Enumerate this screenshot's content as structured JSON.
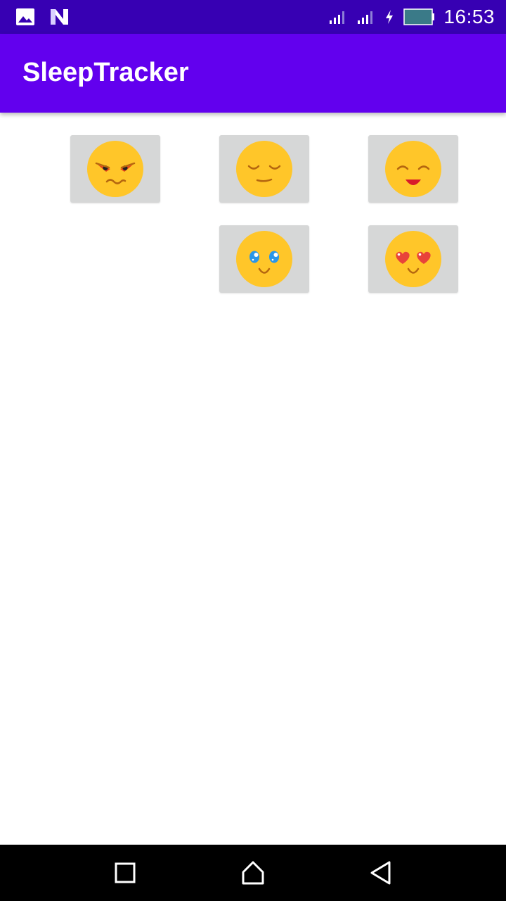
{
  "status_bar": {
    "time": "16:53",
    "icons": [
      "gallery-icon",
      "android-n-icon",
      "signal-icon",
      "signal-icon",
      "charging-icon",
      "battery-icon"
    ]
  },
  "app_bar": {
    "title": "SleepTracker"
  },
  "moods": [
    {
      "name": "angry-face-icon",
      "row": 1,
      "column": 1
    },
    {
      "name": "sleepy-face-icon",
      "row": 1,
      "column": 2
    },
    {
      "name": "content-face-icon",
      "row": 1,
      "column": 3
    },
    {
      "name": "wide-eyed-face-icon",
      "row": 2,
      "column": 2
    },
    {
      "name": "heart-eyes-face-icon",
      "row": 2,
      "column": 3
    }
  ],
  "nav_bar": {
    "icons": [
      "recents-icon",
      "home-icon",
      "back-icon"
    ]
  },
  "colors": {
    "status_bar": "#3700b3",
    "app_bar": "#6200ee",
    "face": "#ffc629",
    "button_bg": "#d6d7d7"
  }
}
